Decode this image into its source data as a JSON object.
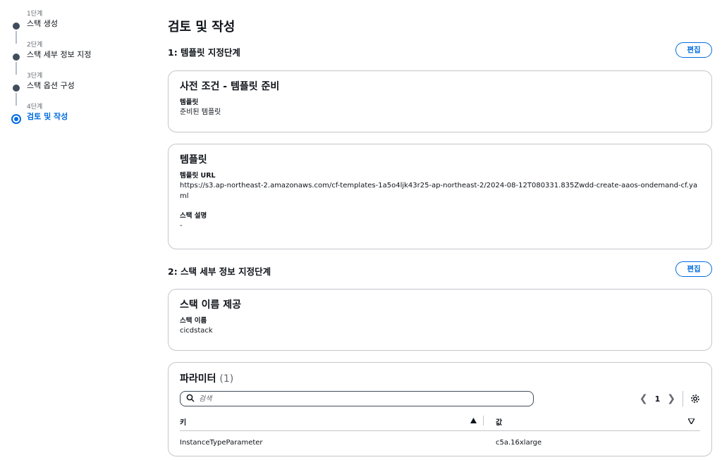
{
  "steps": [
    {
      "sub": "1단계",
      "label": "스택 생성"
    },
    {
      "sub": "2단계",
      "label": "스택 세부 정보 지정"
    },
    {
      "sub": "3단계",
      "label": "스택 옵션 구성"
    },
    {
      "sub": "4단계",
      "label": "검토 및 작성"
    }
  ],
  "page_title": "검토 및 작성",
  "section1": {
    "header": "1: 템플릿 지정단계",
    "edit": "편집",
    "prereq": {
      "title": "사전 조건 - 템플릿 준비",
      "key": "템플릿",
      "value": "준비된 템플릿"
    },
    "template": {
      "title": "템플릿",
      "url_key": "템플릿 URL",
      "url_value": "https://s3.ap-northeast-2.amazonaws.com/cf-templates-1a5o4ljk43r25-ap-northeast-2/2024-08-12T080331.835Zwdd-create-aaos-ondemand-cf.yaml",
      "desc_key": "스택 설명",
      "desc_value": "-"
    }
  },
  "section2": {
    "header": "2: 스택 세부 정보 지정단계",
    "edit": "편집",
    "stack_name": {
      "title": "스택 이름 제공",
      "key": "스택 이름",
      "value": "cicdstack"
    },
    "params": {
      "title": "파라미터",
      "count": "(1)",
      "search_placeholder": "검색",
      "page": "1",
      "col_key": "키",
      "col_value": "값",
      "rows": [
        {
          "key": "InstanceTypeParameter",
          "value": "c5a.16xlarge"
        }
      ]
    }
  }
}
